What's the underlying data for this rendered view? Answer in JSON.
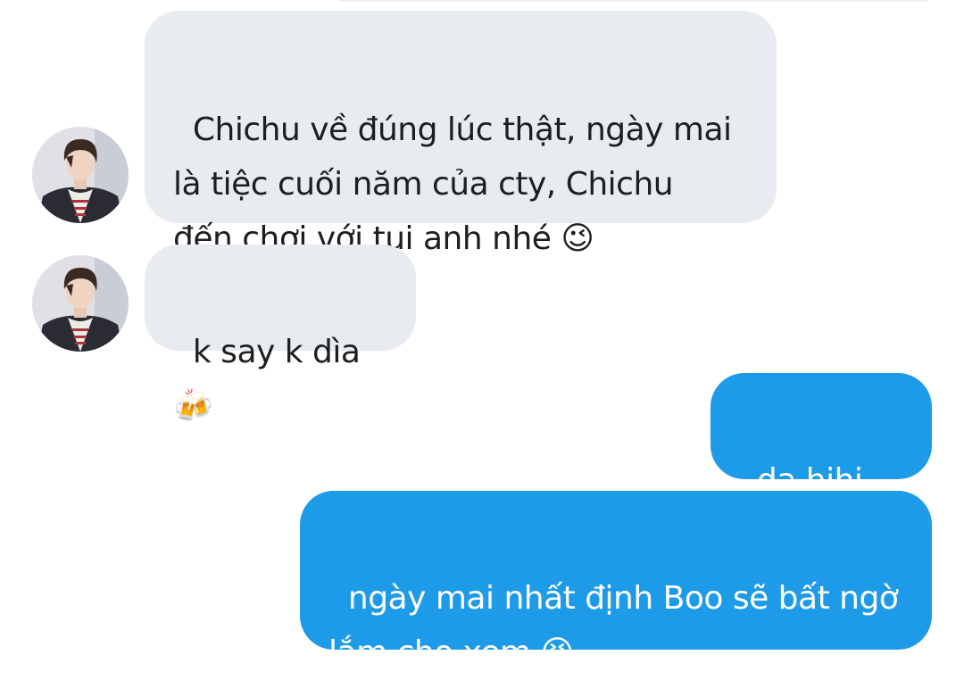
{
  "conversation": {
    "messages": [
      {
        "sender": "contact",
        "text": "Chichu về đúng lúc thật, ngày mai\nlà tiệc cuối năm của cty, Chichu\nđến chơi với tụi anh nhé",
        "emoji": "😉"
      },
      {
        "sender": "contact",
        "text": "k say k dìa",
        "emoji": "🍻"
      },
      {
        "sender": "me",
        "text": "dạ hihi",
        "emoji": "🤭"
      },
      {
        "sender": "me",
        "text": "ngày mai nhất định Boo sẽ bất ngờ\nlắm cho xem",
        "emoji": "😆"
      }
    ]
  },
  "colors": {
    "incoming_bubble": "#e8ebef",
    "outgoing_bubble": "#1e9be8",
    "incoming_text": "#1c1e21",
    "outgoing_text": "#ffffff"
  },
  "icons": {
    "avatar": "contact-avatar-photo"
  }
}
